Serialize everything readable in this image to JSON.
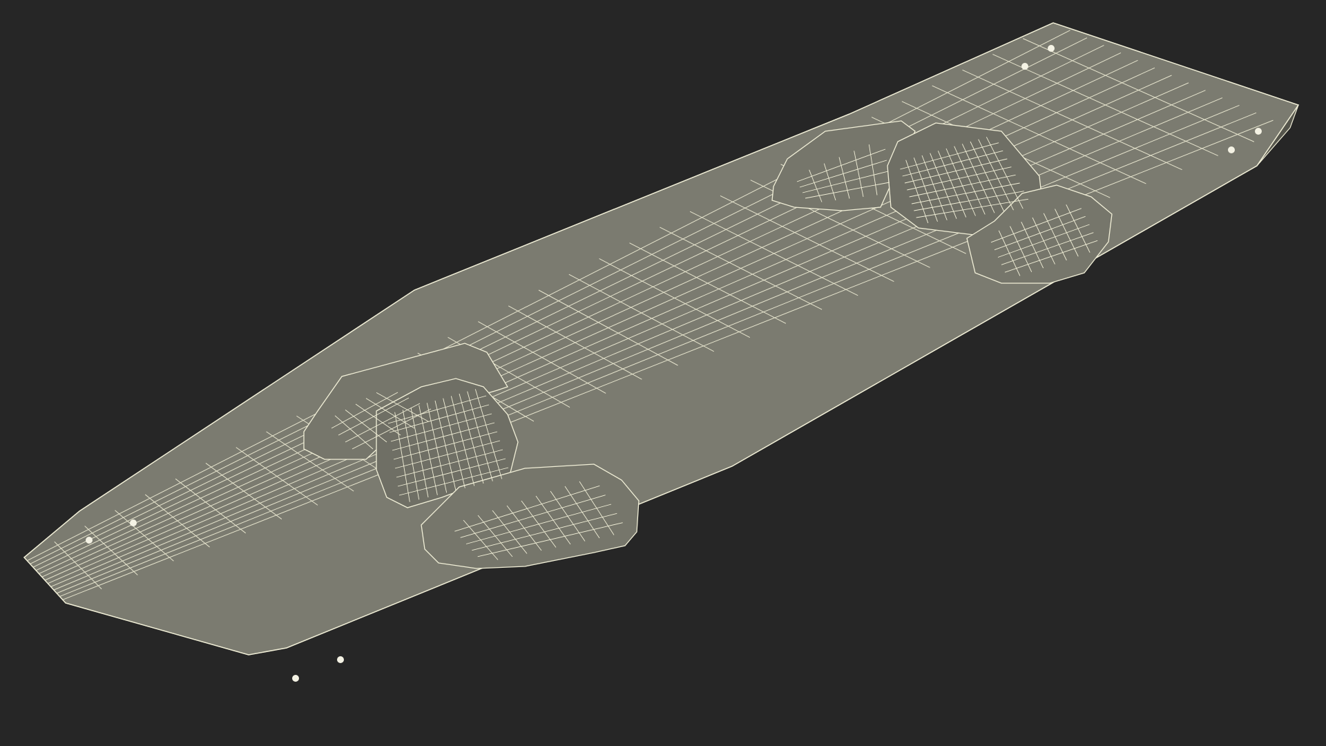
{
  "scene": {
    "subject": "kiteboard-wireframe",
    "colors": {
      "background": "#262626",
      "surface": "#7b7b70",
      "surface_shade": "#6a6a60",
      "rim": "#55554c",
      "wire": "#f2f0d8",
      "pad": "#76766b",
      "screw": "#f4f2e4"
    }
  }
}
